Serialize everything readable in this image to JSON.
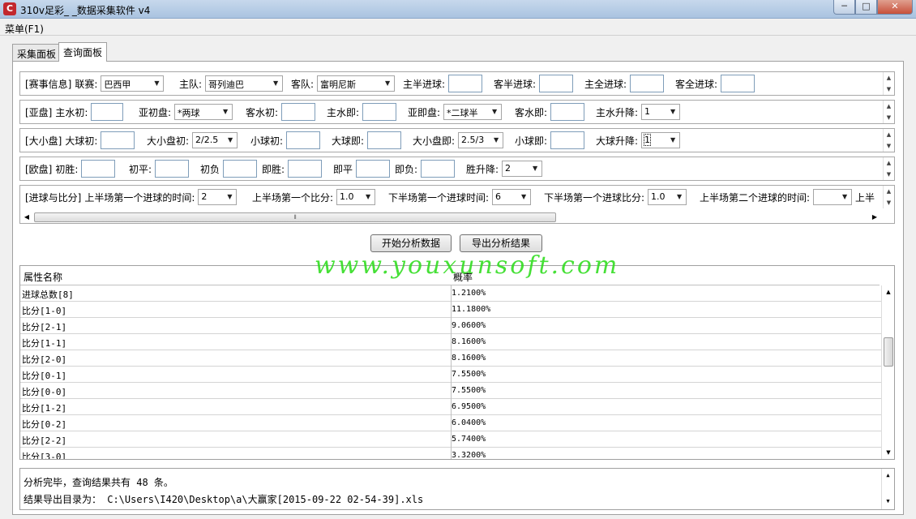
{
  "window": {
    "title": "310v足彩_ _数据采集软件 v4",
    "min": "─",
    "max": "□",
    "close": "✕"
  },
  "menu": {
    "label": "菜单(F1)"
  },
  "tabs": [
    {
      "label": "采集面板"
    },
    {
      "label": "查询面板"
    }
  ],
  "match": {
    "group": "[赛事信息]",
    "league_label": "联赛:",
    "league_value": "巴西甲",
    "home_label": "主队:",
    "home_value": "哥列迪巴",
    "away_label": "客队:",
    "away_value": "富明尼斯",
    "home_half_label": "主半进球:",
    "away_half_label": "客半进球:",
    "home_full_label": "主全进球:",
    "away_full_label": "客全进球:"
  },
  "asian": {
    "group": "[亚盘]",
    "home_water_init_label": "主水初:",
    "handicap_init_label": "亚初盘:",
    "handicap_init_value": "*两球",
    "away_water_init_label": "客水初:",
    "home_water_now_label": "主水即:",
    "handicap_now_label": "亚即盘:",
    "handicap_now_value": "*二球半",
    "away_water_now_label": "客水即:",
    "home_water_rise_label": "主水升降:",
    "home_water_rise_value": "1"
  },
  "goals": {
    "group": "[大小盘]",
    "over_init_label": "大球初:",
    "line_init_label": "大小盘初:",
    "line_init_value": "2/2.5",
    "under_init_label": "小球初:",
    "over_now_label": "大球即:",
    "line_now_label": "大小盘即:",
    "line_now_value": "2.5/3",
    "under_now_label": "小球即:",
    "over_rise_label": "大球升降:",
    "over_rise_value": "1"
  },
  "euro": {
    "group": "[欧盘]",
    "win_init_label": "初胜:",
    "draw_init_label": "初平:",
    "lose_init_label": "初负",
    "win_now_label": "即胜:",
    "draw_now_label": "即平",
    "lose_now_label": "即负:",
    "win_rise_label": "胜升降:",
    "win_rise_value": "2"
  },
  "score": {
    "group": "[进球与比分]",
    "h1_first_time_label": "上半场第一个进球的时间:",
    "h1_first_time_value": "2",
    "h1_first_score_label": "上半场第一个比分:",
    "h1_first_score_value": "1.0",
    "h2_first_time_label": "下半场第一个进球时间:",
    "h2_first_time_value": "6",
    "h2_first_score_label": "下半场第一个进球比分:",
    "h2_first_score_value": "1.0",
    "h1_second_time_label": "上半场第二个进球的时间:",
    "cut_label": "上半"
  },
  "actions": {
    "analyze": "开始分析数据",
    "export": "导出分析结果"
  },
  "watermark": "www.youxunsoft.com",
  "results": {
    "col_name": "属性名称",
    "col_prob": "概率",
    "rows": [
      {
        "name": "进球总数[8]",
        "prob": "1.2100%"
      },
      {
        "name": "比分[1-0]",
        "prob": "11.1800%"
      },
      {
        "name": "比分[2-1]",
        "prob": "9.0600%"
      },
      {
        "name": "比分[1-1]",
        "prob": "8.1600%"
      },
      {
        "name": "比分[2-0]",
        "prob": "8.1600%"
      },
      {
        "name": "比分[0-1]",
        "prob": "7.5500%"
      },
      {
        "name": "比分[0-0]",
        "prob": "7.5500%"
      },
      {
        "name": "比分[1-2]",
        "prob": "6.9500%"
      },
      {
        "name": "比分[0-2]",
        "prob": "6.0400%"
      },
      {
        "name": "比分[2-2]",
        "prob": "5.7400%"
      },
      {
        "name": "比分[3-0]",
        "prob": "3.3200%"
      }
    ]
  },
  "log": {
    "line1": "分析完毕，查询结果共有 48 条。",
    "line2": "结果导出目录为： C:\\Users\\I420\\Desktop\\a\\大赢家[2015-09-22 02-54-39].xls"
  },
  "icons": {
    "up": "▲",
    "down": "▼",
    "left": "◀",
    "right": "▶",
    "grip": "⦀",
    "app": "C"
  },
  "colors": {
    "watermark": "#33dd22",
    "titlebar": "#a9c3e0",
    "close": "#c7503a"
  }
}
